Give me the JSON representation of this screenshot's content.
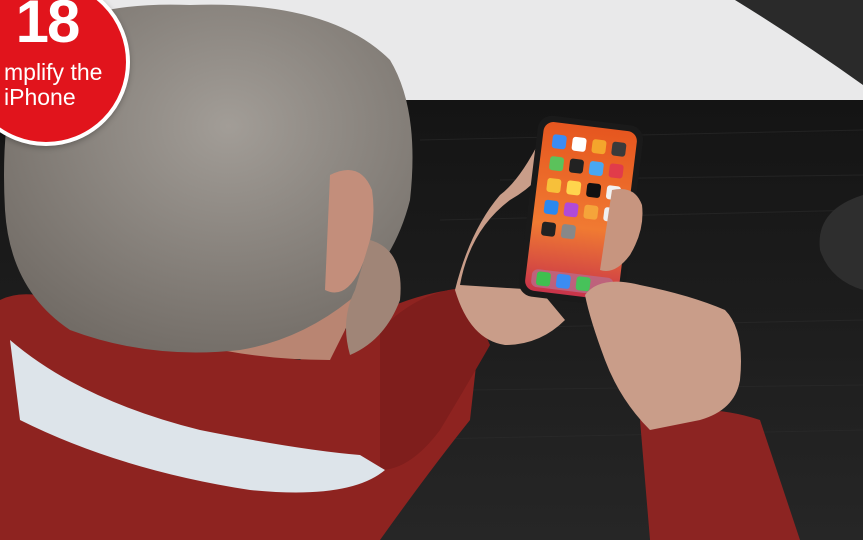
{
  "badge": {
    "number": "18",
    "line1": "mplify the",
    "line2": "iPhone",
    "color": "#e1141c"
  },
  "photo": {
    "colors": {
      "wall": "#e9e9ea",
      "desk": "#1b1b1b",
      "sweater": "#8e2320",
      "collar": "#dde4ea",
      "hair": "#8a8580",
      "skin": "#c99d89",
      "phone_screen": "#ef6a2a"
    }
  }
}
